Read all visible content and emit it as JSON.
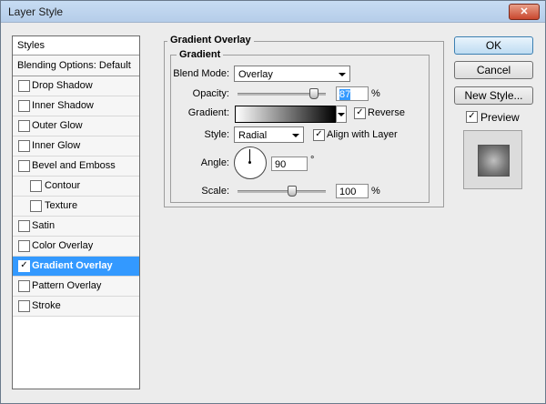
{
  "window": {
    "title": "Layer Style",
    "close_icon": "✕"
  },
  "styles_panel": {
    "header": "Styles",
    "blending_options": "Blending Options: Default",
    "items": [
      {
        "label": "Drop Shadow",
        "checked": false
      },
      {
        "label": "Inner Shadow",
        "checked": false
      },
      {
        "label": "Outer Glow",
        "checked": false
      },
      {
        "label": "Inner Glow",
        "checked": false
      },
      {
        "label": "Bevel and Emboss",
        "checked": false
      },
      {
        "label": "Contour",
        "checked": false
      },
      {
        "label": "Texture",
        "checked": false
      },
      {
        "label": "Satin",
        "checked": false
      },
      {
        "label": "Color Overlay",
        "checked": false
      },
      {
        "label": "Gradient Overlay",
        "checked": true,
        "check_mark": "✓"
      },
      {
        "label": "Pattern Overlay",
        "checked": false
      },
      {
        "label": "Stroke",
        "checked": false
      }
    ]
  },
  "gradient_overlay": {
    "section_title": "Gradient Overlay",
    "group_title": "Gradient",
    "blend_mode": {
      "label": "Blend Mode:",
      "value": "Overlay"
    },
    "opacity": {
      "label": "Opacity:",
      "value": "87",
      "unit": "%",
      "percent": 87
    },
    "gradient": {
      "label": "Gradient:",
      "reverse_label": "Reverse",
      "reverse_checked": true,
      "check_mark": "✓"
    },
    "style": {
      "label": "Style:",
      "value": "Radial",
      "align_label": "Align with Layer",
      "align_checked": true,
      "check_mark": "✓"
    },
    "angle": {
      "label": "Angle:",
      "value": "90",
      "unit": "°"
    },
    "scale": {
      "label": "Scale:",
      "value": "100",
      "unit": "%",
      "percent": 100
    }
  },
  "buttons": {
    "ok": "OK",
    "cancel": "Cancel",
    "new_style": "New Style..."
  },
  "preview": {
    "label": "Preview",
    "checked": true,
    "check_mark": "✓"
  },
  "colors": {
    "selection": "#3399ff",
    "close_red": "#c9472e"
  }
}
